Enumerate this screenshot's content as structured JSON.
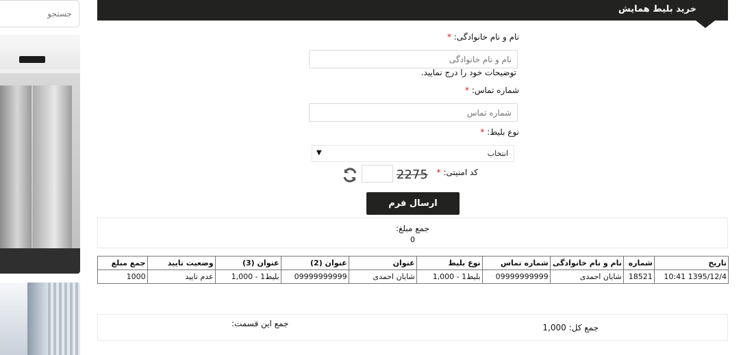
{
  "sidebar": {
    "search_placeholder": "جستجو"
  },
  "header": {
    "title": "خرید بلیط همایش"
  },
  "form": {
    "name_label": "نام و نام خانوادگی:",
    "name_placeholder": "نام و نام خانوادگی",
    "name_hint": "توضیحات خود را درج نمایید.",
    "phone_label": "شماره تماس:",
    "phone_placeholder": "شماره تماس",
    "ticket_label": "نوع بلیط:",
    "ticket_selected": "انتخاب",
    "security_label": "کد امنیتی:",
    "captcha_value": "2275",
    "required_mark": "*",
    "submit_label": "ارسال فرم"
  },
  "sum_box": {
    "label": "جمع مبلغ:",
    "value": "0"
  },
  "table": {
    "headers": [
      "تاریخ",
      "شماره",
      "نام و نام خانوادگی",
      "شماره تماس",
      "نوع بلیط",
      "عنوان",
      "عنوان (2)",
      "عنوان (3)",
      "وضعیت تایید",
      "جمع مبلغ"
    ],
    "rows": [
      [
        "1395/12/4 10:41",
        "18521",
        "شایان احمدی",
        "09999999999",
        "بلیط1 - 1,000",
        "شایان احمدی",
        "09999999999",
        "بلیط1 - 1,000",
        "عدم تایید",
        "1000"
      ]
    ]
  },
  "totals": {
    "section_total_label": "جمع این قسمت:",
    "grand_total_label": "جمع کل: 1,000"
  }
}
